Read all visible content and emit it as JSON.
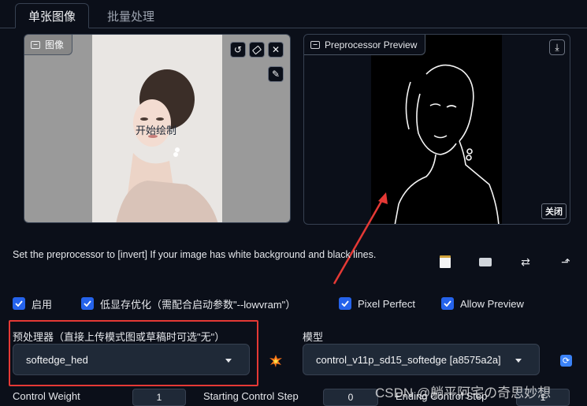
{
  "tabs": [
    {
      "label": "单张图像",
      "active": true
    },
    {
      "label": "批量处理",
      "active": false
    }
  ],
  "image_panel": {
    "label": "图像",
    "canvas_text": "开始绘制",
    "tools": [
      "undo-icon",
      "eraser-icon",
      "close-icon",
      "brush-icon"
    ]
  },
  "preview_panel": {
    "label": "Preprocessor Preview",
    "download_icon": "download-icon",
    "close_label": "关闭"
  },
  "hint": "Set the preprocessor to [invert] If your image has white background and black lines.",
  "action_icons": [
    "memo-icon",
    "camera-icon",
    "swap-icon",
    "send-dimensions-icon"
  ],
  "checkboxes": [
    {
      "label": "启用",
      "checked": true
    },
    {
      "label": "低显存优化（需配合启动参数\"--lowvram\"）",
      "checked": true
    },
    {
      "label": "Pixel Perfect",
      "checked": true
    },
    {
      "label": "Allow Preview",
      "checked": true
    }
  ],
  "preprocessor": {
    "label": "预处理器（直接上传模式图或草稿时可选\"无\"）",
    "value": "softedge_hed"
  },
  "run_icon": "explosion-icon",
  "model": {
    "label": "模型",
    "value": "control_v11p_sd15_softedge [a8575a2a]",
    "refresh_icon": "refresh-icon"
  },
  "sliders": [
    {
      "label": "Control Weight",
      "value": "1"
    },
    {
      "label": "Starting Control Step",
      "value": "0"
    },
    {
      "label": "Ending Control Step",
      "value": "1"
    }
  ],
  "watermark": "CSDN @躺平阿宅の奇思妙想",
  "colors": {
    "background": "#0b0f19",
    "accent": "#2563eb",
    "highlight": "#e53935",
    "border": "#374151"
  }
}
